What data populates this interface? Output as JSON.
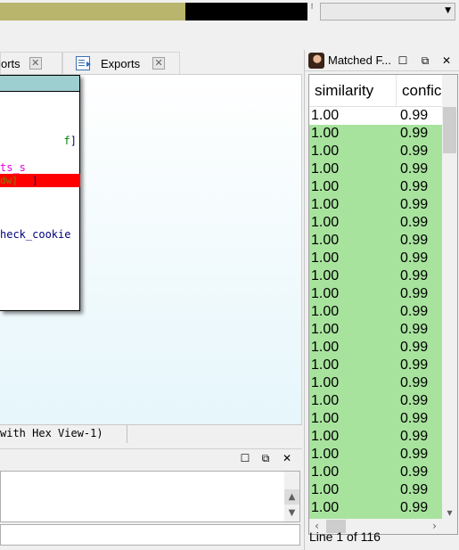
{
  "colors": {
    "library_segment": "#b9b56d",
    "unexplored_segment": "#000000",
    "match_row": "#a8e39e",
    "node_title": "#9ecfd0",
    "highlight": "#ff0000"
  },
  "navigation": {
    "arrow_glyph": "⁝"
  },
  "tabs": [
    {
      "label": "orts",
      "close_glyph": "✕"
    },
    {
      "label": "Exports",
      "close_glyph": "✕"
    }
  ],
  "graph": {
    "code_line_1_a": "f",
    "code_line_1_b": "]",
    "code_line_2": "ts_s",
    "code_line_3_a": "dw]",
    "code_line_3_b": "]",
    "code_line_4": "heck_cookie",
    "status": "with Hex View-1)"
  },
  "output_panel": {
    "restore_glyph": "☐",
    "float_glyph": "⧉",
    "close_glyph": "✕"
  },
  "matched_panel": {
    "title": "Matched F...",
    "restore_glyph": "☐",
    "float_glyph": "⧉",
    "close_glyph": "✕",
    "columns": [
      "similarity",
      "confic"
    ],
    "rows": [
      {
        "similarity": "1.00",
        "confidence": "0.99"
      },
      {
        "similarity": "1.00",
        "confidence": "0.99"
      },
      {
        "similarity": "1.00",
        "confidence": "0.99"
      },
      {
        "similarity": "1.00",
        "confidence": "0.99"
      },
      {
        "similarity": "1.00",
        "confidence": "0.99"
      },
      {
        "similarity": "1.00",
        "confidence": "0.99"
      },
      {
        "similarity": "1.00",
        "confidence": "0.99"
      },
      {
        "similarity": "1.00",
        "confidence": "0.99"
      },
      {
        "similarity": "1.00",
        "confidence": "0.99"
      },
      {
        "similarity": "1.00",
        "confidence": "0.99"
      },
      {
        "similarity": "1.00",
        "confidence": "0.99"
      },
      {
        "similarity": "1.00",
        "confidence": "0.99"
      },
      {
        "similarity": "1.00",
        "confidence": "0.99"
      },
      {
        "similarity": "1.00",
        "confidence": "0.99"
      },
      {
        "similarity": "1.00",
        "confidence": "0.99"
      },
      {
        "similarity": "1.00",
        "confidence": "0.99"
      },
      {
        "similarity": "1.00",
        "confidence": "0.99"
      },
      {
        "similarity": "1.00",
        "confidence": "0.99"
      },
      {
        "similarity": "1.00",
        "confidence": "0.99"
      },
      {
        "similarity": "1.00",
        "confidence": "0.99"
      },
      {
        "similarity": "1.00",
        "confidence": "0.99"
      },
      {
        "similarity": "1.00",
        "confidence": "0.99"
      },
      {
        "similarity": "1.00",
        "confidence": "0.99"
      },
      {
        "similarity": "1.00",
        "confidence": "0.99"
      }
    ],
    "status": "Line 1 of 116"
  }
}
